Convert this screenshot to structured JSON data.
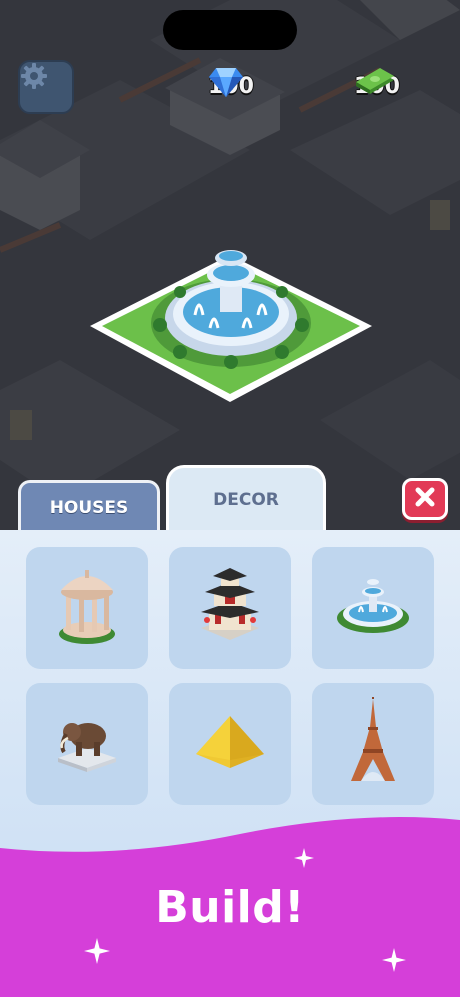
{
  "hud": {
    "gems": "100",
    "cash": "100",
    "settings_icon": "gear-icon",
    "gem_icon": "diamond-icon",
    "cash_icon": "money-stack-icon"
  },
  "tabs": [
    {
      "label": "HOUSES",
      "selected": false
    },
    {
      "label": "DECOR",
      "selected": true
    }
  ],
  "close_icon": "close-icon",
  "decor_items": [
    {
      "icon": "gazebo-icon"
    },
    {
      "icon": "pagoda-icon"
    },
    {
      "icon": "fountain-icon"
    },
    {
      "icon": "mammoth-statue-icon"
    },
    {
      "icon": "pyramid-icon"
    },
    {
      "icon": "eiffel-tower-icon"
    }
  ],
  "build_button": {
    "label": "Build!"
  },
  "colors": {
    "accent": "#d53fd9",
    "close": "#e23a56",
    "panel": "#dce9f4",
    "tab_inactive": "#6f88b4"
  }
}
